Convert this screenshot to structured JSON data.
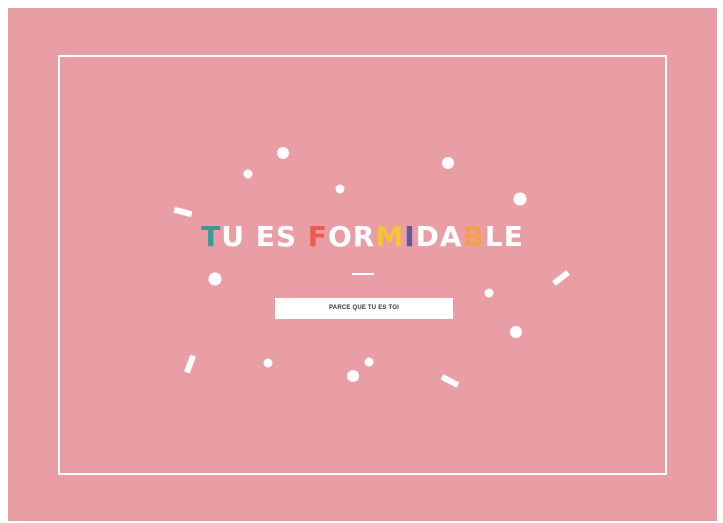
{
  "headline": {
    "letters": [
      {
        "char": "T",
        "color": "#3a9a98"
      },
      {
        "char": "U",
        "color": "#ffffff"
      },
      {
        "char": " ",
        "color": "#ffffff"
      },
      {
        "char": "E",
        "color": "#ffffff"
      },
      {
        "char": "S",
        "color": "#ffffff"
      },
      {
        "char": " ",
        "color": "#ffffff"
      },
      {
        "char": "F",
        "color": "#f05a4a"
      },
      {
        "char": "O",
        "color": "#ffffff"
      },
      {
        "char": "R",
        "color": "#ffffff"
      },
      {
        "char": "M",
        "color": "#f5c23a"
      },
      {
        "char": "I",
        "color": "#5a5aa8"
      },
      {
        "char": "D",
        "color": "#ffffff"
      },
      {
        "char": "A",
        "color": "#ffffff"
      },
      {
        "char": "B",
        "color": "#f5a04a"
      },
      {
        "char": "L",
        "color": "#ffffff"
      },
      {
        "char": "E",
        "color": "#ffffff"
      }
    ]
  },
  "subtitle": "PARCE QUE TU ES TOI",
  "colors": {
    "background": "#e89ea4",
    "frame": "#ffffff",
    "confetti": "#ffffff"
  }
}
